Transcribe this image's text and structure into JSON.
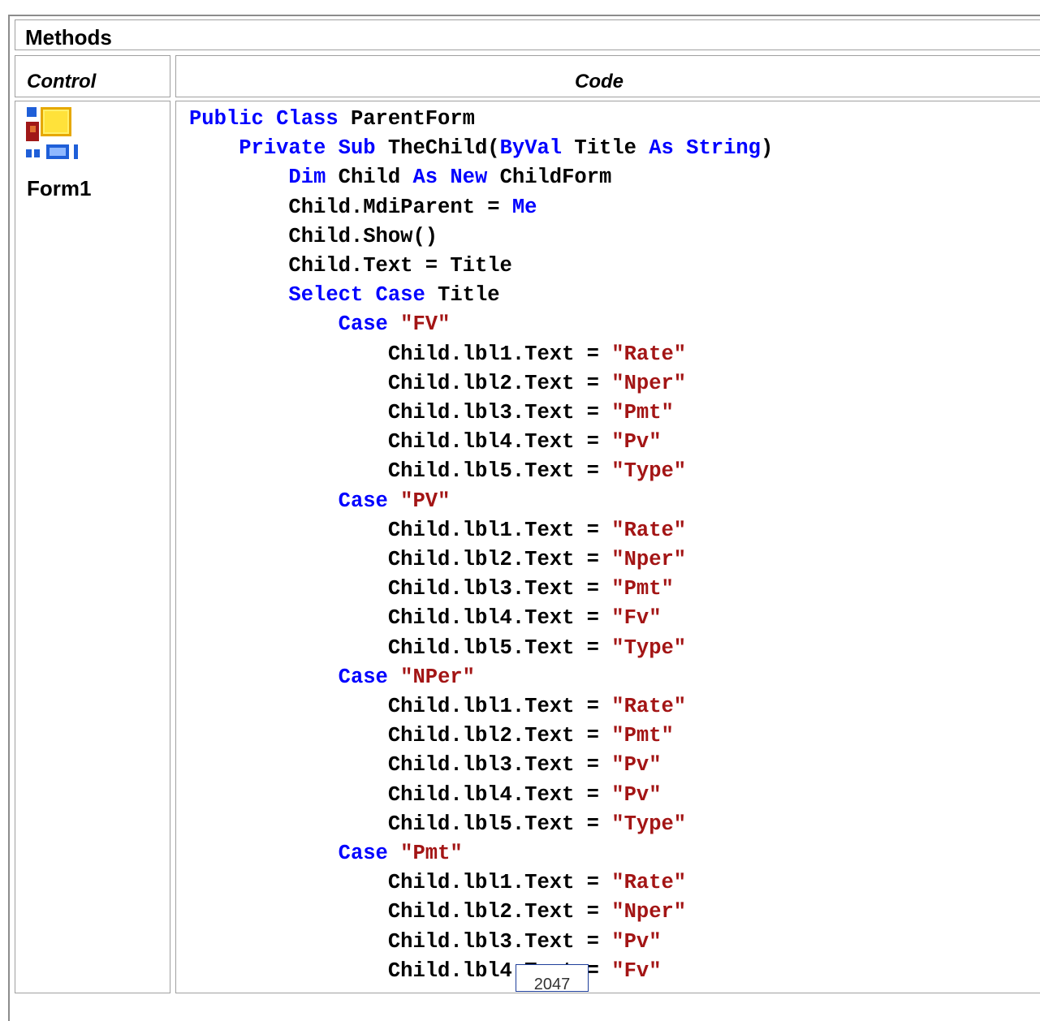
{
  "table": {
    "title": "Methods",
    "headers": {
      "control": "Control",
      "code": "Code"
    },
    "control_label": "Form1",
    "code_lines": [
      [
        [
          "kw",
          "Public Class "
        ],
        [
          "t",
          "ParentForm"
        ]
      ],
      [
        [
          "t",
          "    "
        ],
        [
          "kw",
          "Private Sub "
        ],
        [
          "t",
          "TheChild("
        ],
        [
          "kw",
          "ByVal"
        ],
        [
          "t",
          " Title "
        ],
        [
          "kw",
          "As"
        ],
        [
          "t",
          " "
        ],
        [
          "kw",
          "String"
        ],
        [
          "t",
          ")"
        ]
      ],
      [
        [
          "t",
          "        "
        ],
        [
          "kw",
          "Dim"
        ],
        [
          "t",
          " Child "
        ],
        [
          "kw",
          "As New"
        ],
        [
          "t",
          " ChildForm"
        ]
      ],
      [
        [
          "t",
          "        Child.MdiParent = "
        ],
        [
          "kw",
          "Me"
        ]
      ],
      [
        [
          "t",
          "        Child.Show()"
        ]
      ],
      [
        [
          "t",
          "        Child.Text = Title"
        ]
      ],
      [
        [
          "t",
          "        "
        ],
        [
          "kw",
          "Select Case"
        ],
        [
          "t",
          " Title"
        ]
      ],
      [
        [
          "t",
          "            "
        ],
        [
          "kw",
          "Case"
        ],
        [
          "t",
          " "
        ],
        [
          "str",
          "\"FV\""
        ]
      ],
      [
        [
          "t",
          "                Child.lbl1.Text = "
        ],
        [
          "str",
          "\"Rate\""
        ]
      ],
      [
        [
          "t",
          "                Child.lbl2.Text = "
        ],
        [
          "str",
          "\"Nper\""
        ]
      ],
      [
        [
          "t",
          "                Child.lbl3.Text = "
        ],
        [
          "str",
          "\"Pmt\""
        ]
      ],
      [
        [
          "t",
          "                Child.lbl4.Text = "
        ],
        [
          "str",
          "\"Pv\""
        ]
      ],
      [
        [
          "t",
          "                Child.lbl5.Text = "
        ],
        [
          "str",
          "\"Type\""
        ]
      ],
      [
        [
          "t",
          "            "
        ],
        [
          "kw",
          "Case"
        ],
        [
          "t",
          " "
        ],
        [
          "str",
          "\"PV\""
        ]
      ],
      [
        [
          "t",
          "                Child.lbl1.Text = "
        ],
        [
          "str",
          "\"Rate\""
        ]
      ],
      [
        [
          "t",
          "                Child.lbl2.Text = "
        ],
        [
          "str",
          "\"Nper\""
        ]
      ],
      [
        [
          "t",
          "                Child.lbl3.Text = "
        ],
        [
          "str",
          "\"Pmt\""
        ]
      ],
      [
        [
          "t",
          "                Child.lbl4.Text = "
        ],
        [
          "str",
          "\"Fv\""
        ]
      ],
      [
        [
          "t",
          "                Child.lbl5.Text = "
        ],
        [
          "str",
          "\"Type\""
        ]
      ],
      [
        [
          "t",
          "            "
        ],
        [
          "kw",
          "Case"
        ],
        [
          "t",
          " "
        ],
        [
          "str",
          "\"NPer\""
        ]
      ],
      [
        [
          "t",
          "                Child.lbl1.Text = "
        ],
        [
          "str",
          "\"Rate\""
        ]
      ],
      [
        [
          "t",
          "                Child.lbl2.Text = "
        ],
        [
          "str",
          "\"Pmt\""
        ]
      ],
      [
        [
          "t",
          "                Child.lbl3.Text = "
        ],
        [
          "str",
          "\"Pv\""
        ]
      ],
      [
        [
          "t",
          "                Child.lbl4.Text = "
        ],
        [
          "str",
          "\"Pv\""
        ]
      ],
      [
        [
          "t",
          "                Child.lbl5.Text = "
        ],
        [
          "str",
          "\"Type\""
        ]
      ],
      [
        [
          "t",
          "            "
        ],
        [
          "kw",
          "Case"
        ],
        [
          "t",
          " "
        ],
        [
          "str",
          "\"Pmt\""
        ]
      ],
      [
        [
          "t",
          "                Child.lbl1.Text = "
        ],
        [
          "str",
          "\"Rate\""
        ]
      ],
      [
        [
          "t",
          "                Child.lbl2.Text = "
        ],
        [
          "str",
          "\"Nper\""
        ]
      ],
      [
        [
          "t",
          "                Child.lbl3.Text = "
        ],
        [
          "str",
          "\"Pv\""
        ]
      ],
      [
        [
          "t",
          "                Child.lbl4.Text = "
        ],
        [
          "str",
          "\"Fv\""
        ]
      ]
    ]
  },
  "footer": {
    "page_number": "2047"
  },
  "colors": {
    "keyword": "#0000ff",
    "string": "#a31515",
    "text": "#000000",
    "border": "#a0a0a0"
  },
  "icons": {
    "control_icon": "mdi-form-icon"
  }
}
